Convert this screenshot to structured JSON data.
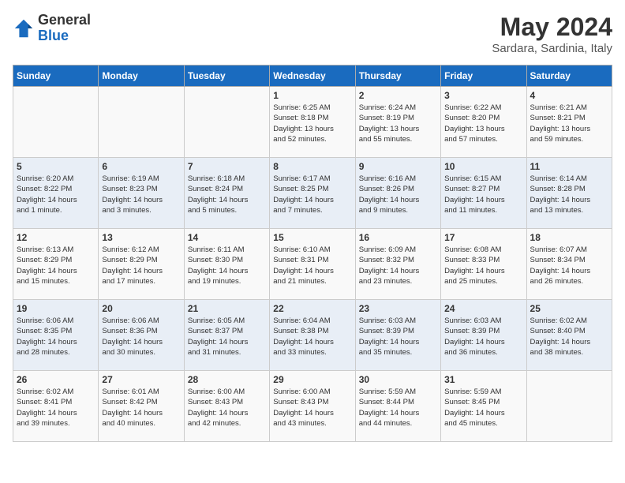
{
  "header": {
    "logo_general": "General",
    "logo_blue": "Blue",
    "title": "May 2024",
    "subtitle": "Sardara, Sardinia, Italy"
  },
  "weekdays": [
    "Sunday",
    "Monday",
    "Tuesday",
    "Wednesday",
    "Thursday",
    "Friday",
    "Saturday"
  ],
  "weeks": [
    [
      {
        "day": "",
        "info": ""
      },
      {
        "day": "",
        "info": ""
      },
      {
        "day": "",
        "info": ""
      },
      {
        "day": "1",
        "info": "Sunrise: 6:25 AM\nSunset: 8:18 PM\nDaylight: 13 hours\nand 52 minutes."
      },
      {
        "day": "2",
        "info": "Sunrise: 6:24 AM\nSunset: 8:19 PM\nDaylight: 13 hours\nand 55 minutes."
      },
      {
        "day": "3",
        "info": "Sunrise: 6:22 AM\nSunset: 8:20 PM\nDaylight: 13 hours\nand 57 minutes."
      },
      {
        "day": "4",
        "info": "Sunrise: 6:21 AM\nSunset: 8:21 PM\nDaylight: 13 hours\nand 59 minutes."
      }
    ],
    [
      {
        "day": "5",
        "info": "Sunrise: 6:20 AM\nSunset: 8:22 PM\nDaylight: 14 hours\nand 1 minute."
      },
      {
        "day": "6",
        "info": "Sunrise: 6:19 AM\nSunset: 8:23 PM\nDaylight: 14 hours\nand 3 minutes."
      },
      {
        "day": "7",
        "info": "Sunrise: 6:18 AM\nSunset: 8:24 PM\nDaylight: 14 hours\nand 5 minutes."
      },
      {
        "day": "8",
        "info": "Sunrise: 6:17 AM\nSunset: 8:25 PM\nDaylight: 14 hours\nand 7 minutes."
      },
      {
        "day": "9",
        "info": "Sunrise: 6:16 AM\nSunset: 8:26 PM\nDaylight: 14 hours\nand 9 minutes."
      },
      {
        "day": "10",
        "info": "Sunrise: 6:15 AM\nSunset: 8:27 PM\nDaylight: 14 hours\nand 11 minutes."
      },
      {
        "day": "11",
        "info": "Sunrise: 6:14 AM\nSunset: 8:28 PM\nDaylight: 14 hours\nand 13 minutes."
      }
    ],
    [
      {
        "day": "12",
        "info": "Sunrise: 6:13 AM\nSunset: 8:29 PM\nDaylight: 14 hours\nand 15 minutes."
      },
      {
        "day": "13",
        "info": "Sunrise: 6:12 AM\nSunset: 8:29 PM\nDaylight: 14 hours\nand 17 minutes."
      },
      {
        "day": "14",
        "info": "Sunrise: 6:11 AM\nSunset: 8:30 PM\nDaylight: 14 hours\nand 19 minutes."
      },
      {
        "day": "15",
        "info": "Sunrise: 6:10 AM\nSunset: 8:31 PM\nDaylight: 14 hours\nand 21 minutes."
      },
      {
        "day": "16",
        "info": "Sunrise: 6:09 AM\nSunset: 8:32 PM\nDaylight: 14 hours\nand 23 minutes."
      },
      {
        "day": "17",
        "info": "Sunrise: 6:08 AM\nSunset: 8:33 PM\nDaylight: 14 hours\nand 25 minutes."
      },
      {
        "day": "18",
        "info": "Sunrise: 6:07 AM\nSunset: 8:34 PM\nDaylight: 14 hours\nand 26 minutes."
      }
    ],
    [
      {
        "day": "19",
        "info": "Sunrise: 6:06 AM\nSunset: 8:35 PM\nDaylight: 14 hours\nand 28 minutes."
      },
      {
        "day": "20",
        "info": "Sunrise: 6:06 AM\nSunset: 8:36 PM\nDaylight: 14 hours\nand 30 minutes."
      },
      {
        "day": "21",
        "info": "Sunrise: 6:05 AM\nSunset: 8:37 PM\nDaylight: 14 hours\nand 31 minutes."
      },
      {
        "day": "22",
        "info": "Sunrise: 6:04 AM\nSunset: 8:38 PM\nDaylight: 14 hours\nand 33 minutes."
      },
      {
        "day": "23",
        "info": "Sunrise: 6:03 AM\nSunset: 8:39 PM\nDaylight: 14 hours\nand 35 minutes."
      },
      {
        "day": "24",
        "info": "Sunrise: 6:03 AM\nSunset: 8:39 PM\nDaylight: 14 hours\nand 36 minutes."
      },
      {
        "day": "25",
        "info": "Sunrise: 6:02 AM\nSunset: 8:40 PM\nDaylight: 14 hours\nand 38 minutes."
      }
    ],
    [
      {
        "day": "26",
        "info": "Sunrise: 6:02 AM\nSunset: 8:41 PM\nDaylight: 14 hours\nand 39 minutes."
      },
      {
        "day": "27",
        "info": "Sunrise: 6:01 AM\nSunset: 8:42 PM\nDaylight: 14 hours\nand 40 minutes."
      },
      {
        "day": "28",
        "info": "Sunrise: 6:00 AM\nSunset: 8:43 PM\nDaylight: 14 hours\nand 42 minutes."
      },
      {
        "day": "29",
        "info": "Sunrise: 6:00 AM\nSunset: 8:43 PM\nDaylight: 14 hours\nand 43 minutes."
      },
      {
        "day": "30",
        "info": "Sunrise: 5:59 AM\nSunset: 8:44 PM\nDaylight: 14 hours\nand 44 minutes."
      },
      {
        "day": "31",
        "info": "Sunrise: 5:59 AM\nSunset: 8:45 PM\nDaylight: 14 hours\nand 45 minutes."
      },
      {
        "day": "",
        "info": ""
      }
    ]
  ]
}
